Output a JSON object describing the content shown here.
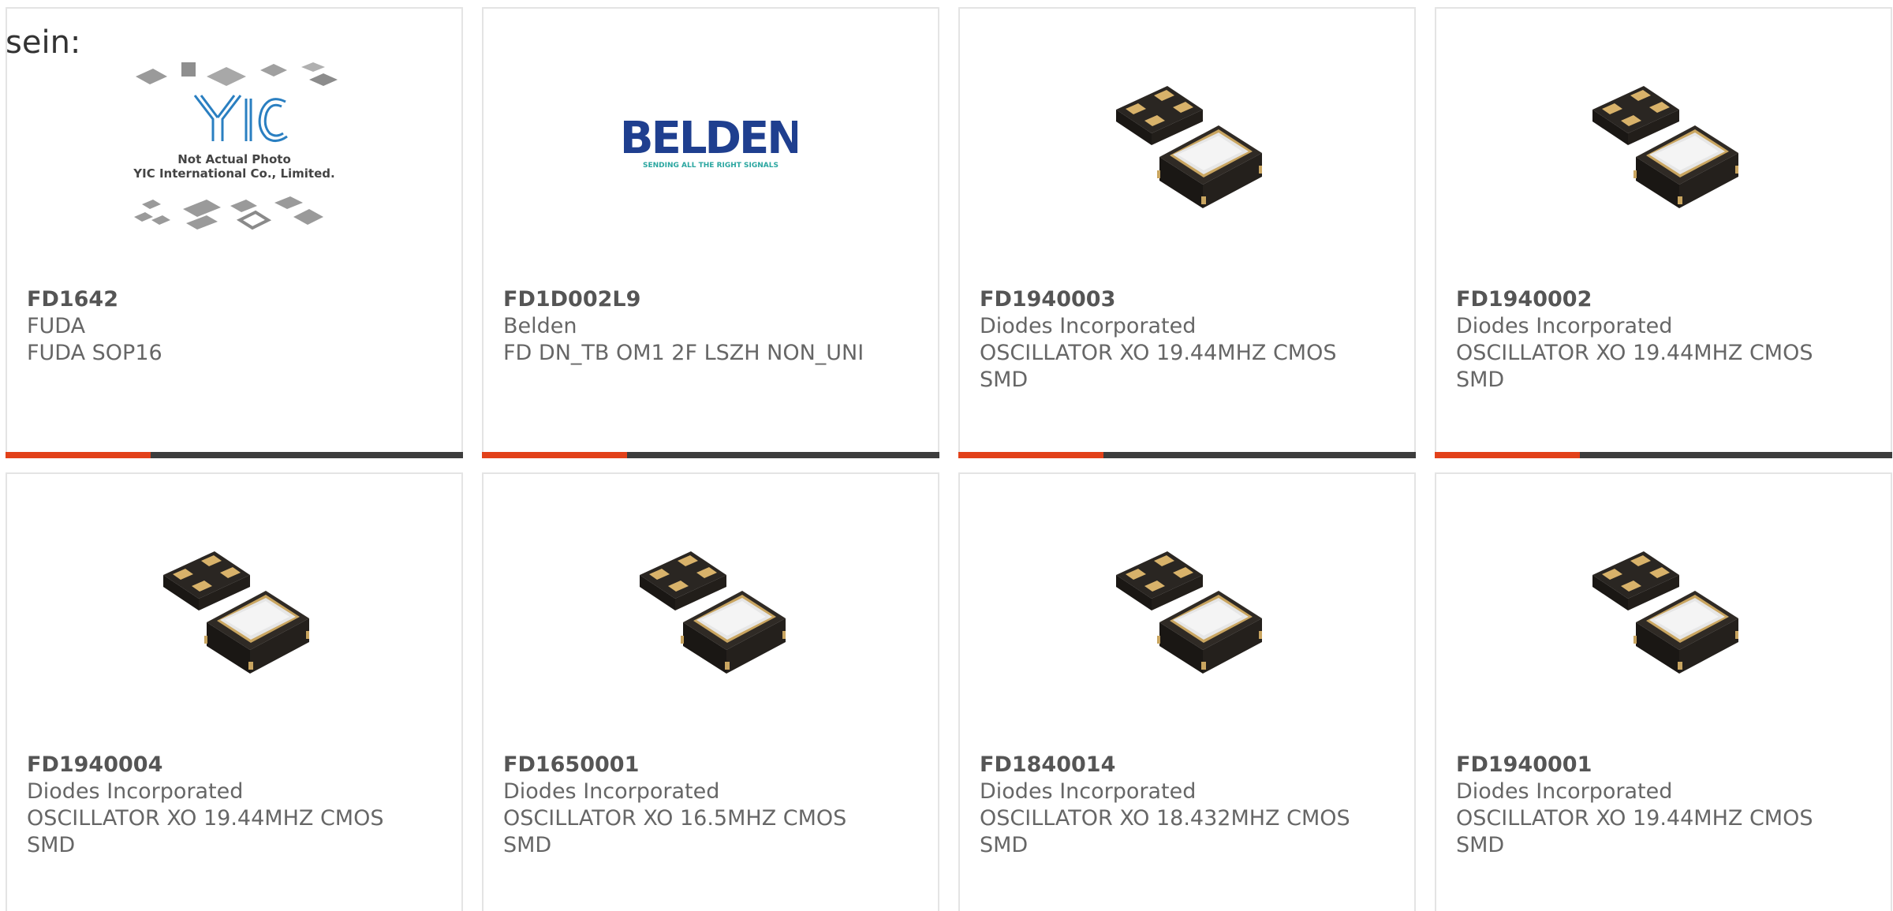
{
  "fragment_text": "sein:",
  "colors": {
    "accent": "#e2411a",
    "bar_dark": "#3d3d3d",
    "text": "#666666",
    "border": "#e4e4e4"
  },
  "cards": [
    {
      "part_number": "FD1642",
      "manufacturer": "FUDA",
      "description": "FUDA SOP16",
      "image": {
        "type": "placeholder-photo",
        "logo_text": "YIC",
        "caption_line1": "Not Actual Photo",
        "caption_line2": "YIC International Co., Limited."
      }
    },
    {
      "part_number": "FD1D002L9",
      "manufacturer": "Belden",
      "description": "FD DN_TB OM1 2F LSZH NON_UNI",
      "image": {
        "type": "brand-logo",
        "brand": "BELDEN",
        "tagline": "SENDING ALL THE RIGHT SIGNALS"
      }
    },
    {
      "part_number": "FD1940003",
      "manufacturer": "Diodes Incorporated",
      "description": "OSCILLATOR XO 19.44MHZ CMOS SMD",
      "image": {
        "type": "oscillator-chip"
      }
    },
    {
      "part_number": "FD1940002",
      "manufacturer": "Diodes Incorporated",
      "description": "OSCILLATOR XO 19.44MHZ CMOS SMD",
      "image": {
        "type": "oscillator-chip"
      }
    },
    {
      "part_number": "FD1940004",
      "manufacturer": "Diodes Incorporated",
      "description": "OSCILLATOR XO 19.44MHZ CMOS SMD",
      "image": {
        "type": "oscillator-chip"
      }
    },
    {
      "part_number": "FD1650001",
      "manufacturer": "Diodes Incorporated",
      "description": "OSCILLATOR XO 16.5MHZ CMOS SMD",
      "image": {
        "type": "oscillator-chip"
      }
    },
    {
      "part_number": "FD1840014",
      "manufacturer": "Diodes Incorporated",
      "description": "OSCILLATOR XO 18.432MHZ CMOS SMD",
      "image": {
        "type": "oscillator-chip"
      }
    },
    {
      "part_number": "FD1940001",
      "manufacturer": "Diodes Incorporated",
      "description": "OSCILLATOR XO 19.44MHZ CMOS SMD",
      "image": {
        "type": "oscillator-chip"
      }
    }
  ]
}
